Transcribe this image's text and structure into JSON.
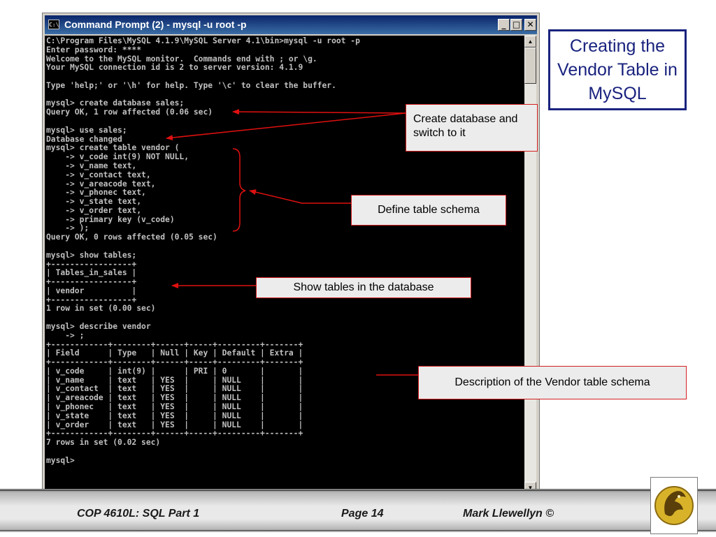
{
  "window": {
    "title": "Command Prompt (2) - mysql -u root -p",
    "icon": "console-icon",
    "controls": {
      "minimize": "_",
      "maximize": "□",
      "close": "✕"
    }
  },
  "console": {
    "lines": [
      "C:\\Program Files\\MySQL 4.1.9\\MySQL Server 4.1\\bin>mysql -u root -p",
      "Enter password: ****",
      "Welcome to the MySQL monitor.  Commands end with ; or \\g.",
      "Your MySQL connection id is 2 to server version: 4.1.9",
      "",
      "Type 'help;' or '\\h' for help. Type '\\c' to clear the buffer.",
      "",
      "mysql> create database sales;",
      "Query OK, 1 row affected (0.06 sec)",
      "",
      "mysql> use sales;",
      "Database changed",
      "mysql> create table vendor (",
      "    -> v_code int(9) NOT NULL,",
      "    -> v_name text,",
      "    -> v_contact text,",
      "    -> v_areacode text,",
      "    -> v_phonec text,",
      "    -> v_state text,",
      "    -> v_order text,",
      "    -> primary key (v_code)",
      "    -> );",
      "Query OK, 0 rows affected (0.05 sec)",
      "",
      "mysql> show tables;",
      "+-----------------+",
      "| Tables_in_sales |",
      "+-----------------+",
      "| vendor          |",
      "+-----------------+",
      "1 row in set (0.00 sec)",
      "",
      "mysql> describe vendor",
      "    -> ;",
      "+------------+--------+------+-----+---------+-------+",
      "| Field      | Type   | Null | Key | Default | Extra |",
      "+------------+--------+------+-----+---------+-------+",
      "| v_code     | int(9) |      | PRI | 0       |       |",
      "| v_name     | text   | YES  |     | NULL    |       |",
      "| v_contact  | text   | YES  |     | NULL    |       |",
      "| v_areacode | text   | YES  |     | NULL    |       |",
      "| v_phonec   | text   | YES  |     | NULL    |       |",
      "| v_state    | text   | YES  |     | NULL    |       |",
      "| v_order    | text   | YES  |     | NULL    |       |",
      "+------------+--------+------+-----+---------+-------+",
      "7 rows in set (0.02 sec)",
      "",
      "mysql>"
    ]
  },
  "slide": {
    "title": "Creating the Vendor Table in MySQL"
  },
  "callouts": {
    "create_db": "Create database and switch to it",
    "schema": "Define table schema",
    "show_tables": "Show tables in the database",
    "description": "Description of the Vendor table schema"
  },
  "footer": {
    "course": "COP 4610L: SQL Part 1",
    "page": "Page 14",
    "author": "Mark Llewellyn ©"
  },
  "colors": {
    "title_blue": "#1a237e",
    "callout_border": "#d42020",
    "arrow": "#e01010"
  }
}
